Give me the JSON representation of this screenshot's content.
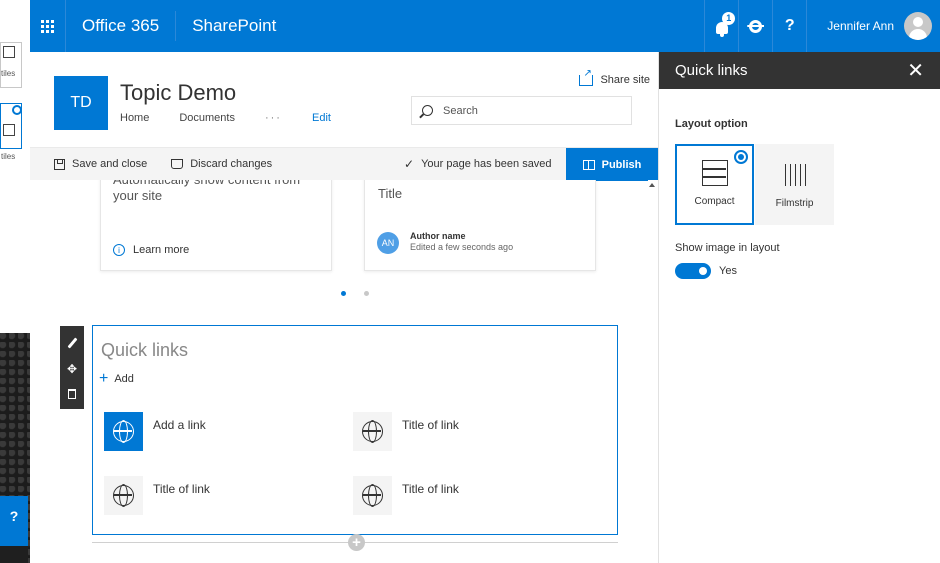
{
  "background_window": {
    "tile1_label": "tiles",
    "tile2_label": "tiles",
    "help_label": "?"
  },
  "suitebar": {
    "brand": "Office 365",
    "app": "SharePoint",
    "notification_count": "1",
    "help": "?",
    "user_name": "Jennifer Ann"
  },
  "site": {
    "logo": "TD",
    "title": "Topic Demo",
    "nav": [
      "Home",
      "Documents",
      "···",
      "Edit"
    ],
    "share_label": "Share site",
    "search_placeholder": "Search"
  },
  "command_bar": {
    "save_close": "Save and close",
    "discard": "Discard changes",
    "status": "Your page has been saved",
    "publish": "Publish"
  },
  "cards": {
    "card1_line1": "Automatically show content from",
    "card1_line2": "your site",
    "card1_learn": "Learn more",
    "card2_title": "Title",
    "card2_initials": "AN",
    "card2_author": "Author name",
    "card2_edited": "Edited a few seconds ago"
  },
  "quick_links": {
    "title": "Quick links",
    "add_label": "Add",
    "links": [
      "Add a link",
      "Title of link",
      "Title of link",
      "Title of link"
    ]
  },
  "pane": {
    "title": "Quick links",
    "close": "✕",
    "layout_label": "Layout option",
    "options": [
      "Compact",
      "Filmstrip"
    ],
    "selected_option": "Compact",
    "image_label": "Show image in layout",
    "toggle_state": "Yes"
  },
  "colors": {
    "accent": "#0078d4",
    "pane_header": "#333333"
  }
}
